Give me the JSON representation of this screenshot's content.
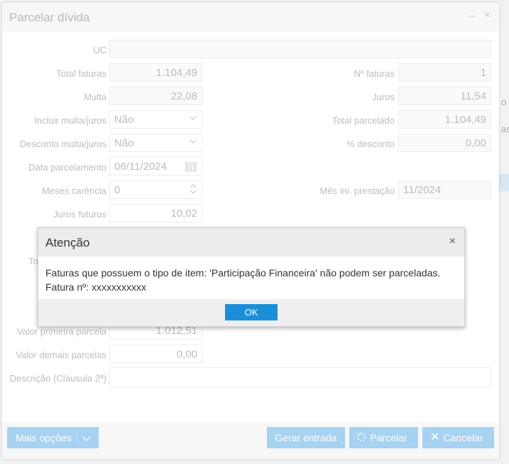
{
  "dialog": {
    "title": "Parcelar dívida",
    "minimize_glyph": "–",
    "close_glyph": "×"
  },
  "form": {
    "uc_label": "UC",
    "uc_value": "",
    "total_faturas_label": "Total faturas",
    "total_faturas_value": "1.104,49",
    "n_faturas_label": "Nº faturas",
    "n_faturas_value": "1",
    "multa_label": "Multa",
    "multa_value": "22,08",
    "juros_label": "Juros",
    "juros_value": "11,54",
    "incluir_label": "Incluir multa/juros",
    "incluir_value": "Não",
    "total_parcelado_label": "Total parcelado",
    "total_parcelado_value": "1.104,49",
    "desconto_label": "Desconto multa/juros",
    "desconto_value": "Não",
    "pct_desconto_label": "% desconto",
    "pct_desconto_value": "0,00",
    "data_label": "Data parcelamento",
    "data_value": "06/11/2024",
    "meses_label": "Meses carência",
    "meses_value": "0",
    "mes_ini_label": "Mês ini. prestação",
    "mes_ini_value": "11/2024",
    "juros_futuros_label": "Juros futuros",
    "juros_futuros_value": "10,02",
    "hidden_label_fragment": "To",
    "primeira_label": "Valor primeira parcela",
    "primeira_value": "1.012,51",
    "demais_label": "Valor demais parcelas",
    "demais_value": "0,00",
    "descricao_label": "Descrição (Cláusula 2ª)",
    "descricao_value": ""
  },
  "footer": {
    "mais_opcoes": "Mais opções",
    "gerar_entrada": "Gerar entrada",
    "parcelar": "Parcelar",
    "cancelar": "Cancelar"
  },
  "background": {
    "right_text_1": "o",
    "right_text_2": "as"
  },
  "alert": {
    "title": "Atenção",
    "close_glyph": "×",
    "message_line1": "Faturas que possuem o tipo de item: 'Participação Financeira' não podem ser parceladas.",
    "message_line2_label": "Fatura nº:",
    "message_line2_value": "xxxxxxxxxxx",
    "ok_label": "OK"
  },
  "icons": {
    "dropdown": "chevron-down-icon",
    "calendar": "calendar-icon",
    "spinner": "stepper-icon",
    "loading": "loading-icon",
    "cancel": "close-icon"
  },
  "colors": {
    "primary_button": "#1a8fd8",
    "disabled_button": "#a7d2f1"
  }
}
